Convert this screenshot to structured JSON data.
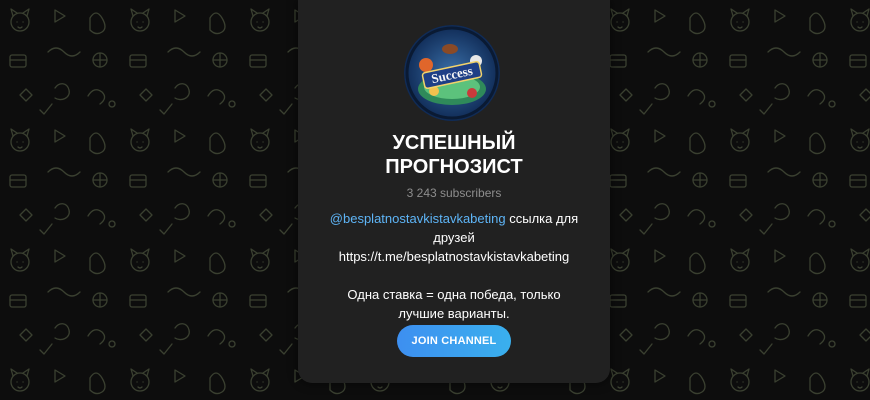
{
  "channel": {
    "title_line1": "УСПЕШНЫЙ",
    "title_line2": "ПРОГНОЗИСТ",
    "subscribers": "3 243 subscribers",
    "avatar_text": "Success",
    "description": {
      "mention": "@besplatnostavkistavkabeting",
      "mention_suffix": " ссылка для друзей",
      "link": "https://t.me/besplatnostavkistavkabeting",
      "text": "Одна ставка = одна победа, только лучшие варианты."
    },
    "join_label": "JOIN CHANNEL"
  },
  "colors": {
    "page_bg": "#0d0d0d",
    "card_bg": "#212121",
    "accent": "#3d8ff0",
    "link": "#5eb5f7"
  }
}
